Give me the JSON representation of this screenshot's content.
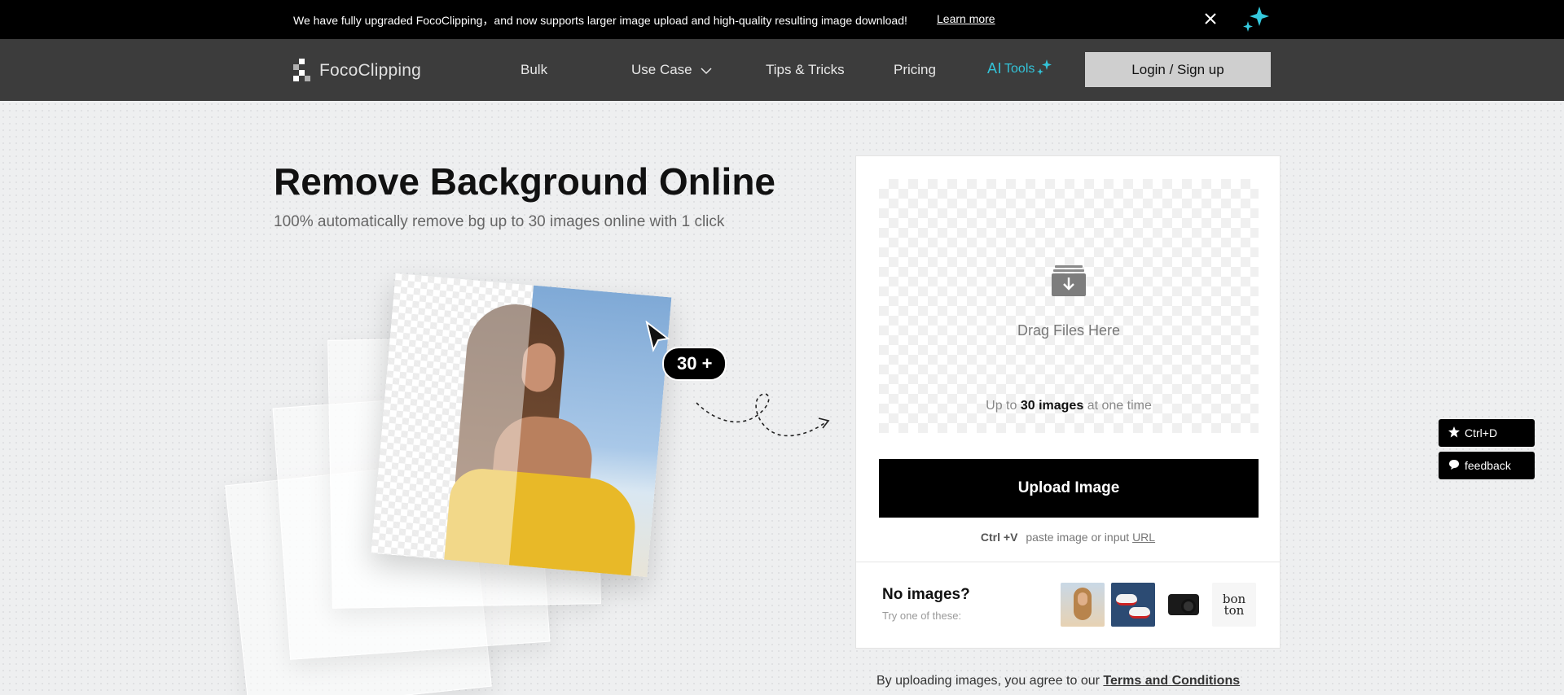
{
  "announcement": {
    "message": "We have fully upgraded FocoClipping，and now supports larger image upload and high-quality resulting image download!",
    "link": "Learn more"
  },
  "nav": {
    "logo": "FocoClipping",
    "items": [
      "Bulk",
      "Use Case",
      "Tips & Tricks",
      "Pricing"
    ],
    "ai_prefix": "AI",
    "ai_label": "Tools",
    "login": "Login / Sign up"
  },
  "hero": {
    "title": "Remove Background Online",
    "subtitle": "100% automatically remove bg up to 30 images online with 1 click",
    "badge": "30 +"
  },
  "upload": {
    "drag_text": "Drag Files Here",
    "limit_prefix": "Up to",
    "limit_bold": "30 images",
    "limit_suffix": "at one time",
    "button": "Upload Image",
    "paste_shortcut": "Ctrl +V",
    "paste_text": "paste image or input",
    "paste_link": "URL",
    "no_images_title": "No images?",
    "no_images_sub": "Try one of these:",
    "sample_text": "bon ton"
  },
  "terms": {
    "prefix": "By uploading images, you agree to our",
    "link": "Terms and Conditions"
  },
  "side": {
    "bookmark": "Ctrl+D",
    "feedback": "feedback"
  },
  "colors": {
    "accent": "#33c3d8",
    "nav_bg": "#3c3c3c",
    "primary_button": "#000000"
  }
}
